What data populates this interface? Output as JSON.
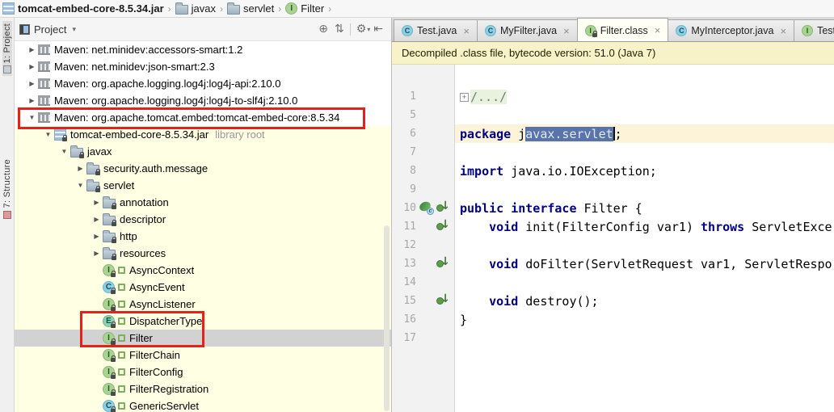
{
  "breadcrumb": {
    "items": [
      {
        "icon": "jar-icon",
        "label": "tomcat-embed-core-8.5.34.jar",
        "bold": true
      },
      {
        "icon": "package-folder-icon",
        "label": "javax",
        "bold": false
      },
      {
        "icon": "package-folder-icon",
        "label": "servlet",
        "bold": false
      },
      {
        "icon": "interface-icon",
        "label": "Filter",
        "bold": false
      }
    ],
    "separator": "›"
  },
  "stripe": {
    "tabs": [
      {
        "label": "1: Project",
        "icon": "project-tool-icon",
        "active": true
      },
      {
        "label": "7: Structure",
        "icon": "structure-tool-icon",
        "active": false
      }
    ]
  },
  "project_panel": {
    "title": "Project",
    "dropdown_arrow": "▾",
    "toolbar": [
      {
        "name": "locate-icon",
        "glyph": "⊕"
      },
      {
        "name": "collapse-all-icon",
        "glyph": "⇅"
      },
      {
        "name": "separator",
        "glyph": ""
      },
      {
        "name": "gear-icon",
        "glyph": "⚙",
        "dropdown": true
      },
      {
        "name": "hide-panel-icon",
        "glyph": "⇤"
      }
    ],
    "tree": [
      {
        "arrow": "right",
        "icon": "maven-lib",
        "label": "Maven: net.minidev:accessors-smart:1.2",
        "indent": 1,
        "lib": false
      },
      {
        "arrow": "right",
        "icon": "maven-lib",
        "label": "Maven: net.minidev:json-smart:2.3",
        "indent": 1,
        "lib": false
      },
      {
        "arrow": "right",
        "icon": "maven-lib",
        "label": "Maven: org.apache.logging.log4j:log4j-api:2.10.0",
        "indent": 1,
        "lib": false
      },
      {
        "arrow": "right",
        "icon": "maven-lib",
        "label": "Maven: org.apache.logging.log4j:log4j-to-slf4j:2.10.0",
        "indent": 1,
        "lib": false
      },
      {
        "arrow": "down",
        "icon": "maven-lib",
        "label": "Maven: org.apache.tomcat.embed:tomcat-embed-core:8.5.34",
        "indent": 1,
        "lib": false
      },
      {
        "arrow": "down",
        "icon": "jar",
        "label": "tomcat-embed-core-8.5.34.jar",
        "suffix": "library root",
        "indent": 2,
        "lib": true
      },
      {
        "arrow": "down",
        "icon": "package",
        "label": "javax",
        "indent": 3,
        "lib": true
      },
      {
        "arrow": "right",
        "icon": "package",
        "label": "security.auth.message",
        "indent": 4,
        "lib": true
      },
      {
        "arrow": "down",
        "icon": "package",
        "label": "servlet",
        "indent": 4,
        "lib": true
      },
      {
        "arrow": "right",
        "icon": "package",
        "label": "annotation",
        "indent": 5,
        "lib": true
      },
      {
        "arrow": "right",
        "icon": "package",
        "label": "descriptor",
        "indent": 5,
        "lib": true
      },
      {
        "arrow": "right",
        "icon": "package",
        "label": "http",
        "indent": 5,
        "lib": true
      },
      {
        "arrow": "right",
        "icon": "package",
        "label": "resources",
        "indent": 5,
        "lib": true
      },
      {
        "arrow": "none",
        "icon": "interface",
        "label": "AsyncContext",
        "indent": 5,
        "lib": true,
        "marker": true
      },
      {
        "arrow": "none",
        "icon": "class",
        "label": "AsyncEvent",
        "indent": 5,
        "lib": true,
        "marker": true
      },
      {
        "arrow": "none",
        "icon": "interface",
        "label": "AsyncListener",
        "indent": 5,
        "lib": true,
        "marker": true
      },
      {
        "arrow": "none",
        "icon": "enum",
        "label": "DispatcherType",
        "indent": 5,
        "lib": true,
        "marker": true
      },
      {
        "arrow": "none",
        "icon": "interface",
        "label": "Filter",
        "indent": 5,
        "lib": true,
        "marker": true,
        "selected": true
      },
      {
        "arrow": "none",
        "icon": "interface",
        "label": "FilterChain",
        "indent": 5,
        "lib": true,
        "marker": true
      },
      {
        "arrow": "none",
        "icon": "interface",
        "label": "FilterConfig",
        "indent": 5,
        "lib": true,
        "marker": true
      },
      {
        "arrow": "none",
        "icon": "interface",
        "label": "FilterRegistration",
        "indent": 5,
        "lib": true,
        "marker": true
      },
      {
        "arrow": "none",
        "icon": "class",
        "label": "GenericServlet",
        "indent": 5,
        "lib": true,
        "marker": true
      }
    ]
  },
  "editor": {
    "tabs": [
      {
        "icon": "class",
        "label": "Test.java",
        "close": true,
        "active": false,
        "lock": false
      },
      {
        "icon": "class",
        "label": "MyFilter.java",
        "close": true,
        "active": false,
        "lock": false
      },
      {
        "icon": "interface",
        "label": "Filter.class",
        "close": true,
        "active": true,
        "lock": true
      },
      {
        "icon": "class",
        "label": "MyInterceptor.java",
        "close": true,
        "active": false,
        "lock": false
      },
      {
        "icon": "interface",
        "label": "TestS",
        "close": false,
        "active": false,
        "lock": false
      }
    ],
    "banner": "Decompiled .class file, bytecode version: 51.0 (Java 7)",
    "lines": [
      {
        "num": "1",
        "gutter": [],
        "cur": false,
        "segments": [
          {
            "s": "foldbox",
            "t": "+"
          },
          {
            "s": "fold",
            "t": "/.../"
          }
        ]
      },
      {
        "num": "5",
        "gutter": [],
        "cur": false,
        "segments": []
      },
      {
        "num": "6",
        "gutter": [],
        "cur": true,
        "segments": [
          {
            "s": "kw",
            "t": "package"
          },
          {
            "s": "p",
            "t": " j"
          },
          {
            "s": "sel",
            "t": "avax.servlet"
          },
          {
            "s": "caret",
            "t": ""
          },
          {
            "s": "p",
            "t": ";"
          }
        ]
      },
      {
        "num": "7",
        "gutter": [],
        "cur": false,
        "segments": []
      },
      {
        "num": "8",
        "gutter": [],
        "cur": false,
        "segments": [
          {
            "s": "kw",
            "t": "import"
          },
          {
            "s": "p",
            "t": " java.io.IOException;"
          }
        ]
      },
      {
        "num": "9",
        "gutter": [],
        "cur": false,
        "segments": []
      },
      {
        "num": "10",
        "gutter": [
          "implementations",
          "implemented"
        ],
        "cur": false,
        "segments": [
          {
            "s": "kw",
            "t": "public"
          },
          {
            "s": "p",
            "t": " "
          },
          {
            "s": "kw",
            "t": "interface"
          },
          {
            "s": "p",
            "t": " Filter {"
          }
        ]
      },
      {
        "num": "11",
        "gutter": [
          "implemented"
        ],
        "cur": false,
        "segments": [
          {
            "s": "p",
            "t": "    "
          },
          {
            "s": "kw",
            "t": "void"
          },
          {
            "s": "p",
            "t": " init(FilterConfig var1) "
          },
          {
            "s": "kw",
            "t": "throws"
          },
          {
            "s": "p",
            "t": " ServletExce"
          }
        ]
      },
      {
        "num": "12",
        "gutter": [],
        "cur": false,
        "segments": []
      },
      {
        "num": "13",
        "gutter": [
          "implemented"
        ],
        "cur": false,
        "segments": [
          {
            "s": "p",
            "t": "    "
          },
          {
            "s": "kw",
            "t": "void"
          },
          {
            "s": "p",
            "t": " doFilter(ServletRequest var1, ServletRespo"
          }
        ]
      },
      {
        "num": "14",
        "gutter": [],
        "cur": false,
        "segments": []
      },
      {
        "num": "15",
        "gutter": [
          "implemented"
        ],
        "cur": false,
        "segments": [
          {
            "s": "p",
            "t": "    "
          },
          {
            "s": "kw",
            "t": "void"
          },
          {
            "s": "p",
            "t": " destroy();"
          }
        ]
      },
      {
        "num": "16",
        "gutter": [],
        "cur": false,
        "segments": [
          {
            "s": "p",
            "t": "}"
          }
        ]
      },
      {
        "num": "17",
        "gutter": [],
        "cur": false,
        "segments": []
      }
    ]
  },
  "colors": {
    "annotation_red": "#E8201A",
    "selection_blue": "#5974AB",
    "banner_yellow": "#F8F2C9",
    "library_row_yellow": "#FFFFE4",
    "keyword_navy": "#000080",
    "current_line": "#FCF3D8",
    "selected_row_gray": "#D2D2D2"
  }
}
